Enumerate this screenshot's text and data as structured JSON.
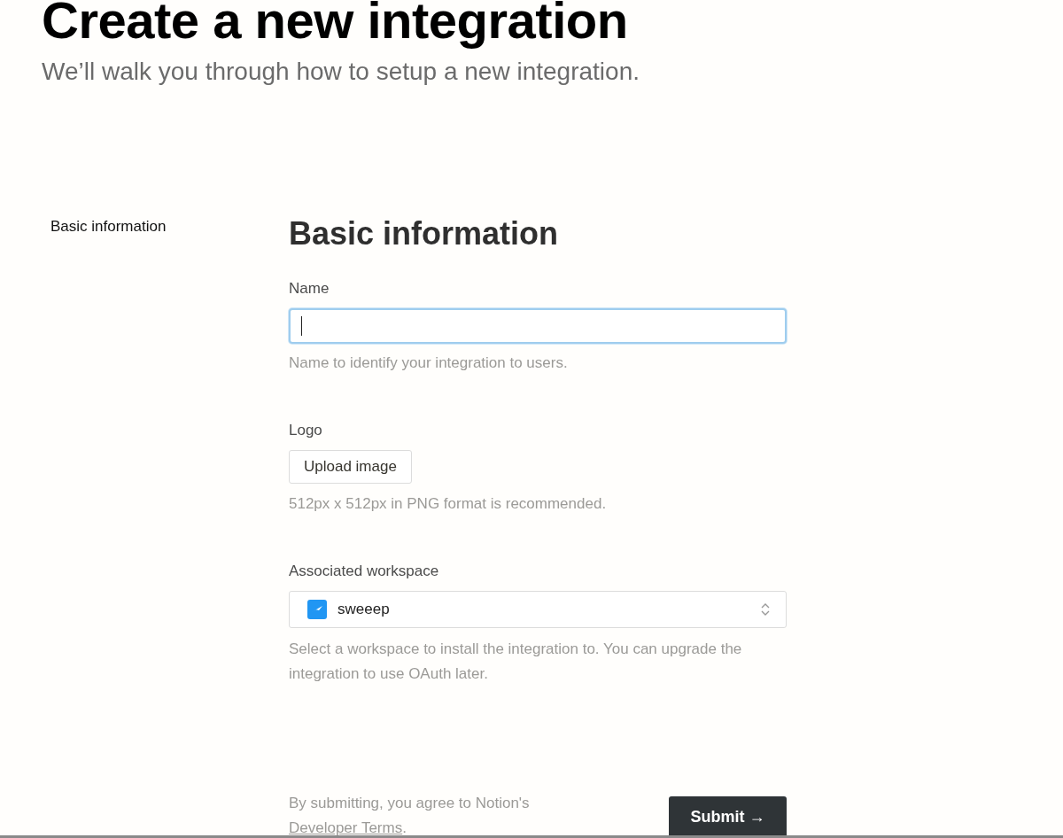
{
  "header": {
    "title": "Create a new integration",
    "subtitle": "We’ll walk you through how to setup a new integration."
  },
  "sidebar": {
    "items": [
      {
        "label": "Basic information"
      }
    ]
  },
  "section": {
    "heading": "Basic information",
    "name_field": {
      "label": "Name",
      "hint": "Name to identify your integration to users."
    },
    "logo": {
      "label": "Logo",
      "button": "Upload image",
      "hint": "512px x 512px in PNG format is recommended."
    },
    "workspace": {
      "label": "Associated workspace",
      "value": "sweeep",
      "hint": "Select a workspace to install the integration to. You can upgrade the integration to use OAuth later."
    }
  },
  "footer": {
    "terms_before": "By submitting, you agree to Notion's ",
    "terms_link": "Developer Terms",
    "terms_after": ".",
    "submit": "Submit →"
  }
}
